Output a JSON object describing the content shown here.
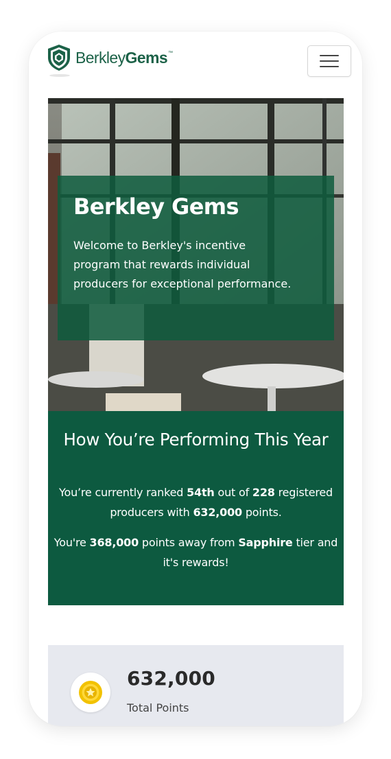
{
  "brand": {
    "name_light": "Berkley",
    "name_bold": "Gems",
    "trademark": "™",
    "primary_color": "#0d5a40",
    "logo_icon": "shield-gem-icon"
  },
  "nav": {
    "menu_icon": "hamburger-menu-icon"
  },
  "hero": {
    "title": "Berkley Gems",
    "description": "Welcome to Berkley's incentive program that rewards individual producers for exceptional performance."
  },
  "performance": {
    "title": "How You’re Performing This Year",
    "rank_prefix": "You’re currently ranked",
    "rank": "54th",
    "rank_middle": "out of",
    "total_producers": "228",
    "rank_suffix": "registered producers with",
    "points": "632,000",
    "points_suffix": "points.",
    "away_prefix": "You're",
    "points_away": "368,000",
    "away_middle": "points away from",
    "next_tier": "Sapphire",
    "away_suffix": "tier and it's rewards!"
  },
  "stats": {
    "total_points_value": "632,000",
    "total_points_label": "Total Points",
    "icon": "gold-star-medal-icon"
  }
}
